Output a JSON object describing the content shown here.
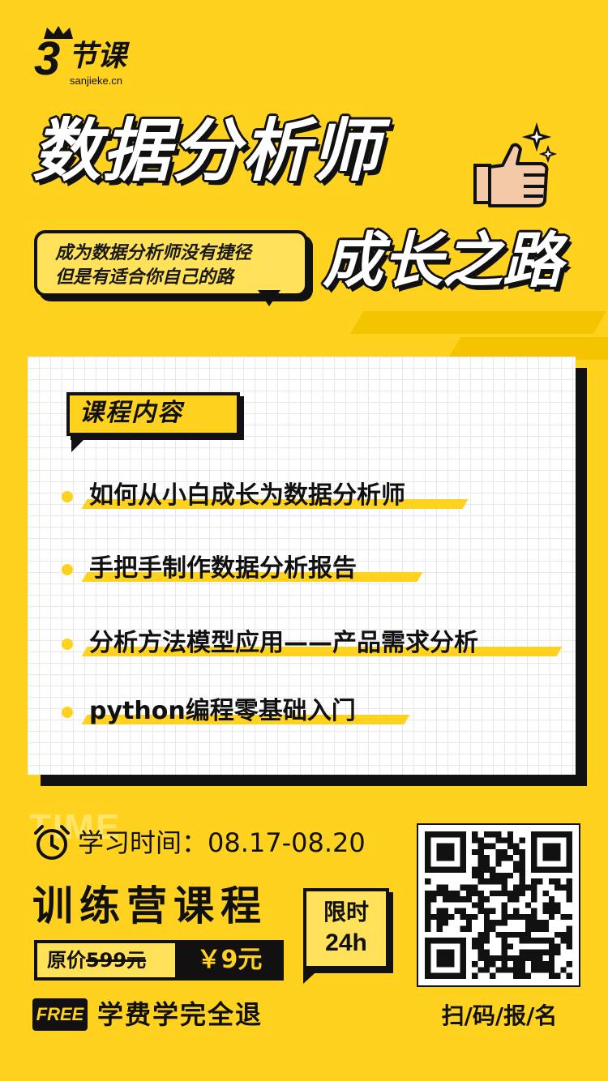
{
  "brand": {
    "logo_digit": "3",
    "logo_name": "节课",
    "logo_url": "sanjieke.cn"
  },
  "hero": {
    "title": "数据分析师",
    "bubble_line1": "成为数据分析师没有捷径",
    "bubble_line2": "但是有适合你自己的路",
    "subtitle": "成长之路"
  },
  "course": {
    "section_title": "课程内容",
    "items": [
      "如何从小白成长为数据分析师",
      "手把手制作数据分析报告",
      "分析方法模型应用——产品需求分析",
      "python编程零基础入门"
    ]
  },
  "schedule": {
    "bg_word": "TIME",
    "study_time": "学习时间：08.17-08.20"
  },
  "offer": {
    "camp_title": "训练营课程",
    "original_label": "原价",
    "original_price": "599元",
    "new_price": "￥9元",
    "limit_line1": "限时",
    "limit_line2": "24h",
    "free_badge": "FREE",
    "free_text": "学费学完全退"
  },
  "signup": {
    "scan_text": "扫/码/报/名"
  },
  "colors": {
    "background": "#FFD21F",
    "accent_dark": "#111111",
    "card": "#FFFFFF"
  }
}
